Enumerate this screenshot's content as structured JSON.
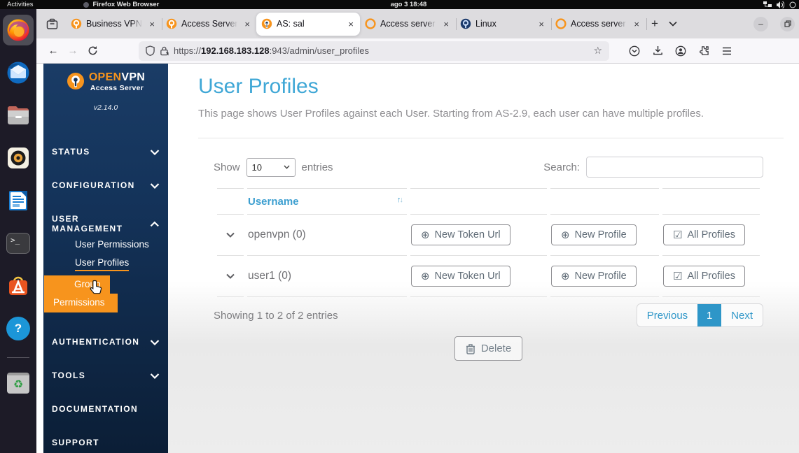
{
  "top_bar": {
    "activities_label": "Activities",
    "focused_app": "Firefox Web Browser",
    "clock": "ago 3 18:48"
  },
  "browser": {
    "tabs": [
      {
        "label": "Business VPN",
        "active": false
      },
      {
        "label": "Access Server",
        "active": false
      },
      {
        "label": "AS: sal",
        "active": true
      },
      {
        "label": "Access server",
        "active": false
      },
      {
        "label": "Linux",
        "active": false
      },
      {
        "label": "Access server",
        "active": false
      }
    ],
    "address": {
      "scheme": "https://",
      "host": "192.168.183.128",
      "path": ":943/admin/user_profiles"
    }
  },
  "sidebar": {
    "logo_open": "OPEN",
    "logo_vpn": "VPN",
    "logo_subtitle": "Access Server",
    "version": "v2.14.0",
    "nav": [
      {
        "label": "STATUS"
      },
      {
        "label": "CONFIGURATION"
      },
      {
        "label": "USER MANAGEMENT"
      },
      {
        "label": "AUTHENTICATION"
      },
      {
        "label": "TOOLS"
      },
      {
        "label": "DOCUMENTATION"
      },
      {
        "label": "SUPPORT"
      }
    ],
    "user_management_children": {
      "user_permissions": "User Permissions",
      "user_profiles": "User Profiles",
      "group_permissions_line1": "Group",
      "group_permissions_line2": "Permissions"
    }
  },
  "main": {
    "title": "User Profiles",
    "description": "This page shows User Profiles against each User. Starting from AS-2.9, each user can have multiple profiles.",
    "show_label": "Show",
    "page_size": "10",
    "entries_label": "entries",
    "search_label": "Search:",
    "search_value": "",
    "table": {
      "username_header": "Username",
      "rows": [
        {
          "username": "openvpn (0)"
        },
        {
          "username": "user1 (0)"
        }
      ]
    },
    "row_buttons": {
      "new_token_url": "New Token Url",
      "new_profile": "New Profile",
      "all_profiles": "All Profiles"
    },
    "summary": "Showing 1 to 2 of 2 entries",
    "pagination": {
      "previous": "Previous",
      "current_page": "1",
      "next": "Next"
    },
    "delete_label": "Delete"
  },
  "glyphs": {
    "close": "×",
    "new_tab": "+",
    "minimize": "–",
    "back": "←",
    "forward": "→",
    "star": "☆",
    "sort_up": "↑",
    "sort_down": "↓",
    "plus_circle": "⊕",
    "checkbox": "☑",
    "terminal_prompt": ">_",
    "help": "?",
    "recycle": "♻"
  },
  "colors": {
    "openvpn_orange": "#f7941d",
    "heading_blue": "#3fa7d6",
    "pagination_blue": "#2e96c8",
    "sidebar_navy_top": "#17375f",
    "sidebar_navy_bottom": "#0b1e36"
  }
}
